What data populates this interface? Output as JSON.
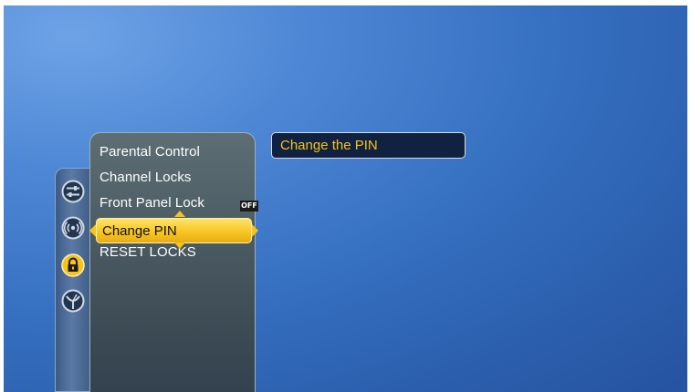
{
  "menu": {
    "items": [
      {
        "label": "Parental Control"
      },
      {
        "label": "Channel Locks"
      },
      {
        "label": "Front Panel Lock",
        "badge": "OFF"
      },
      {
        "label": "Change PIN",
        "selected": true
      },
      {
        "label": "RESET LOCKS"
      }
    ]
  },
  "rail": {
    "icons": [
      "settings-sliders-icon",
      "antenna-signal-icon",
      "padlock-icon",
      "satellite-dish-icon"
    ],
    "active": "padlock-icon"
  },
  "info": {
    "text": "Change the PIN"
  },
  "colors": {
    "highlight": "#f6c21d",
    "background": "#3670c0",
    "panel": "#4b5b63",
    "info_bg": "#10223f"
  }
}
